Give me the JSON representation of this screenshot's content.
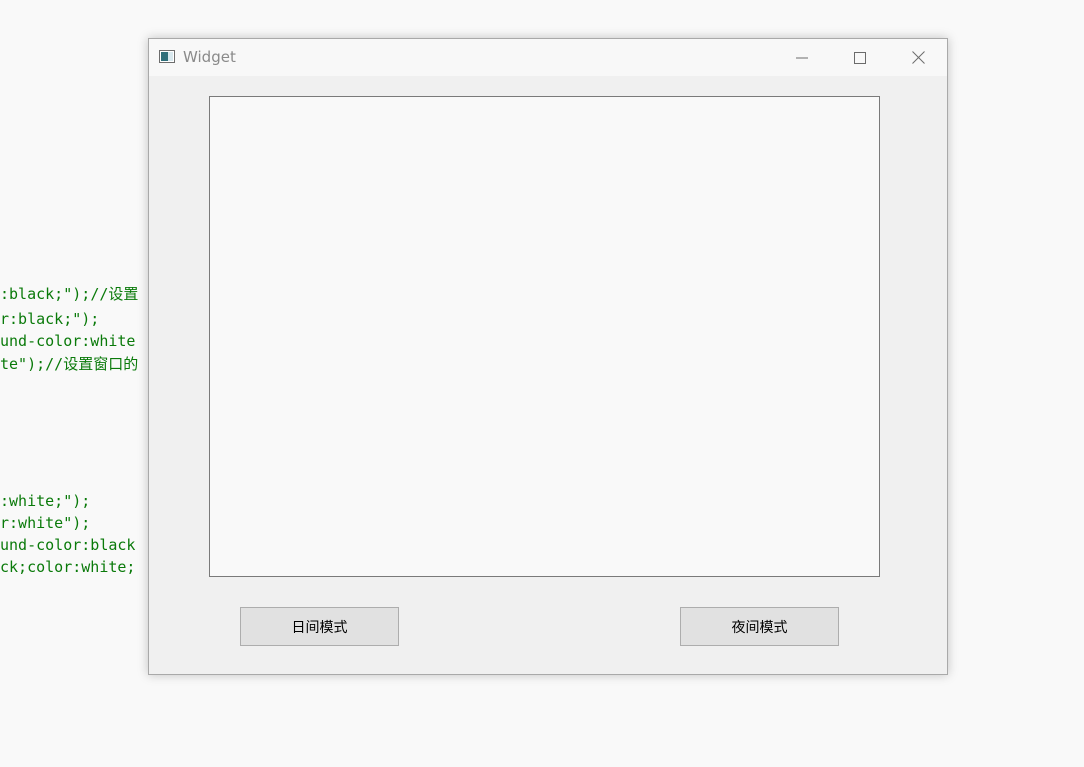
{
  "background_code": {
    "lines": [
      {
        "code": ":black;\");",
        "comment": "//设置"
      },
      {
        "code": "r:black;\");",
        "comment": ""
      },
      {
        "code": "und-color:white",
        "comment": ""
      },
      {
        "code": "te\");",
        "comment": "//设置窗口的"
      },
      {
        "code": ":white;\");",
        "comment": ""
      },
      {
        "code": "r:white\");",
        "comment": ""
      },
      {
        "code": "und-color:black",
        "comment": ""
      },
      {
        "code": "ck;color:white;",
        "comment": ""
      }
    ]
  },
  "window": {
    "title": "Widget",
    "icon": "app-window-icon",
    "controls": {
      "minimize": "minimize-icon",
      "maximize": "maximize-icon",
      "close": "close-icon"
    }
  },
  "buttons": {
    "day_mode": "日间模式",
    "night_mode": "夜间模式"
  },
  "colors": {
    "code_string": "#0a7a0a",
    "window_bg": "#f0f0f0",
    "button_bg": "#e1e1e1"
  }
}
